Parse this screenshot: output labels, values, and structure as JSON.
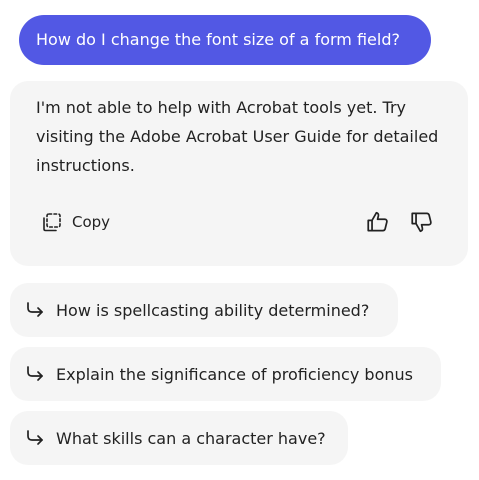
{
  "user_message": {
    "text": "How do I change the font size of a form field?"
  },
  "assistant_message": {
    "text": "I'm not able to help with Acrobat tools yet. Try visiting the Adobe Acrobat User Guide for detailed instructions.",
    "copy_label": "Copy",
    "icons": {
      "copy": "copy-icon",
      "thumbs_up": "thumbs-up-icon",
      "thumbs_down": "thumbs-down-icon"
    }
  },
  "suggestions": [
    {
      "label": "How is spellcasting ability determined?",
      "icon": "reply-arrow-icon"
    },
    {
      "label": "Explain the significance of proficiency bonus",
      "icon": "reply-arrow-icon"
    },
    {
      "label": "What skills can a character have?",
      "icon": "reply-arrow-icon"
    }
  ],
  "colors": {
    "user_bubble": "#5258e4",
    "card_background": "#f5f5f5",
    "text": "#222222"
  }
}
